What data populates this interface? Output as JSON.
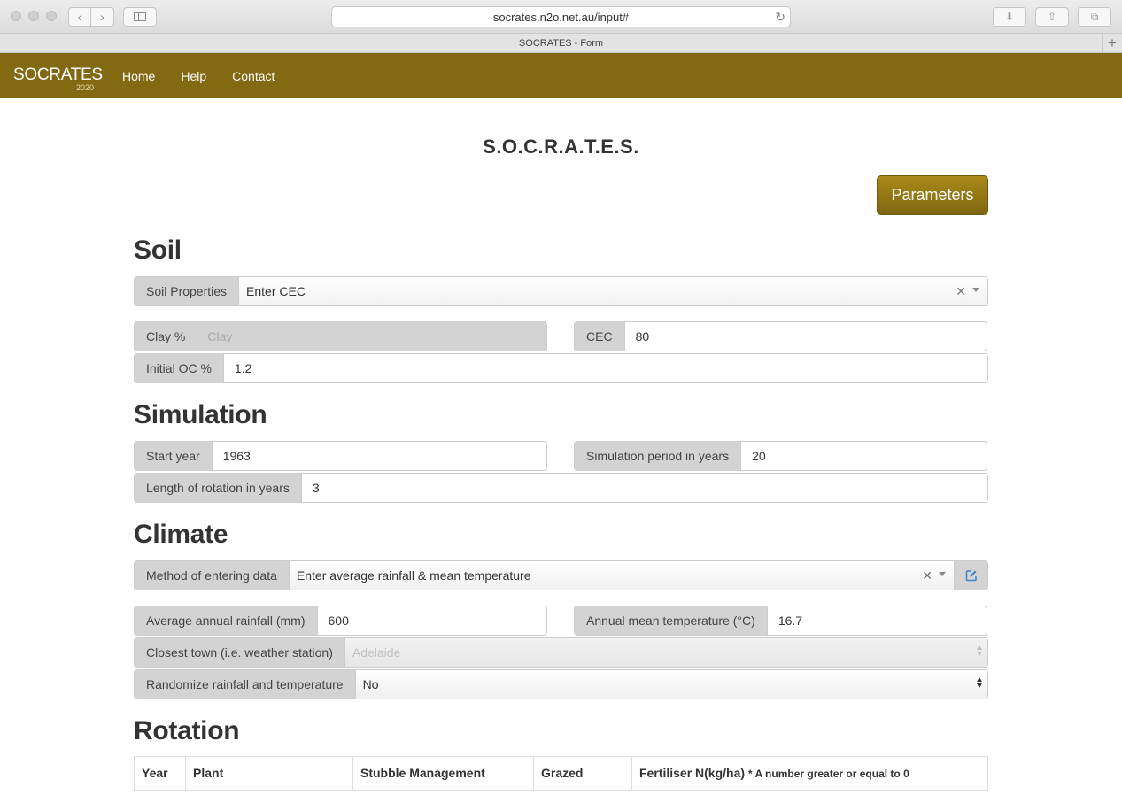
{
  "browser": {
    "url": "socrates.n2o.net.au/input#",
    "tab_title": "SOCRATES - Form"
  },
  "navbar": {
    "brand": "SOCRATES",
    "brand_sub": "2020",
    "links": [
      "Home",
      "Help",
      "Contact"
    ]
  },
  "page": {
    "title": "S.O.C.R.A.T.E.S.",
    "parameters_button": "Parameters"
  },
  "soil": {
    "heading": "Soil",
    "properties_label": "Soil Properties",
    "properties_value": "Enter CEC",
    "clay_label": "Clay %",
    "clay_placeholder": "Clay",
    "cec_label": "CEC",
    "cec_value": "80",
    "initial_oc_label": "Initial OC %",
    "initial_oc_value": "1.2"
  },
  "simulation": {
    "heading": "Simulation",
    "start_year_label": "Start year",
    "start_year_value": "1963",
    "period_label": "Simulation period in years",
    "period_value": "20",
    "rotation_length_label": "Length of rotation in years",
    "rotation_length_value": "3"
  },
  "climate": {
    "heading": "Climate",
    "method_label": "Method of entering data",
    "method_value": "Enter average rainfall & mean temperature",
    "rainfall_label": "Average annual rainfall (mm)",
    "rainfall_value": "600",
    "temperature_label": "Annual mean temperature (°C)",
    "temperature_value": "16.7",
    "town_label": "Closest town (i.e. weather station)",
    "town_value": "Adelaide",
    "randomize_label": "Randomize rainfall and temperature",
    "randomize_value": "No"
  },
  "rotation": {
    "heading": "Rotation",
    "columns": [
      "Year",
      "Plant",
      "Stubble Management",
      "Grazed",
      "Fertiliser N(kg/ha)"
    ],
    "fertiliser_note": "* A number greater or equal to 0"
  },
  "colors": {
    "navbar": "#826912",
    "button": "#9c7f17",
    "addon": "#d3d3d3"
  }
}
